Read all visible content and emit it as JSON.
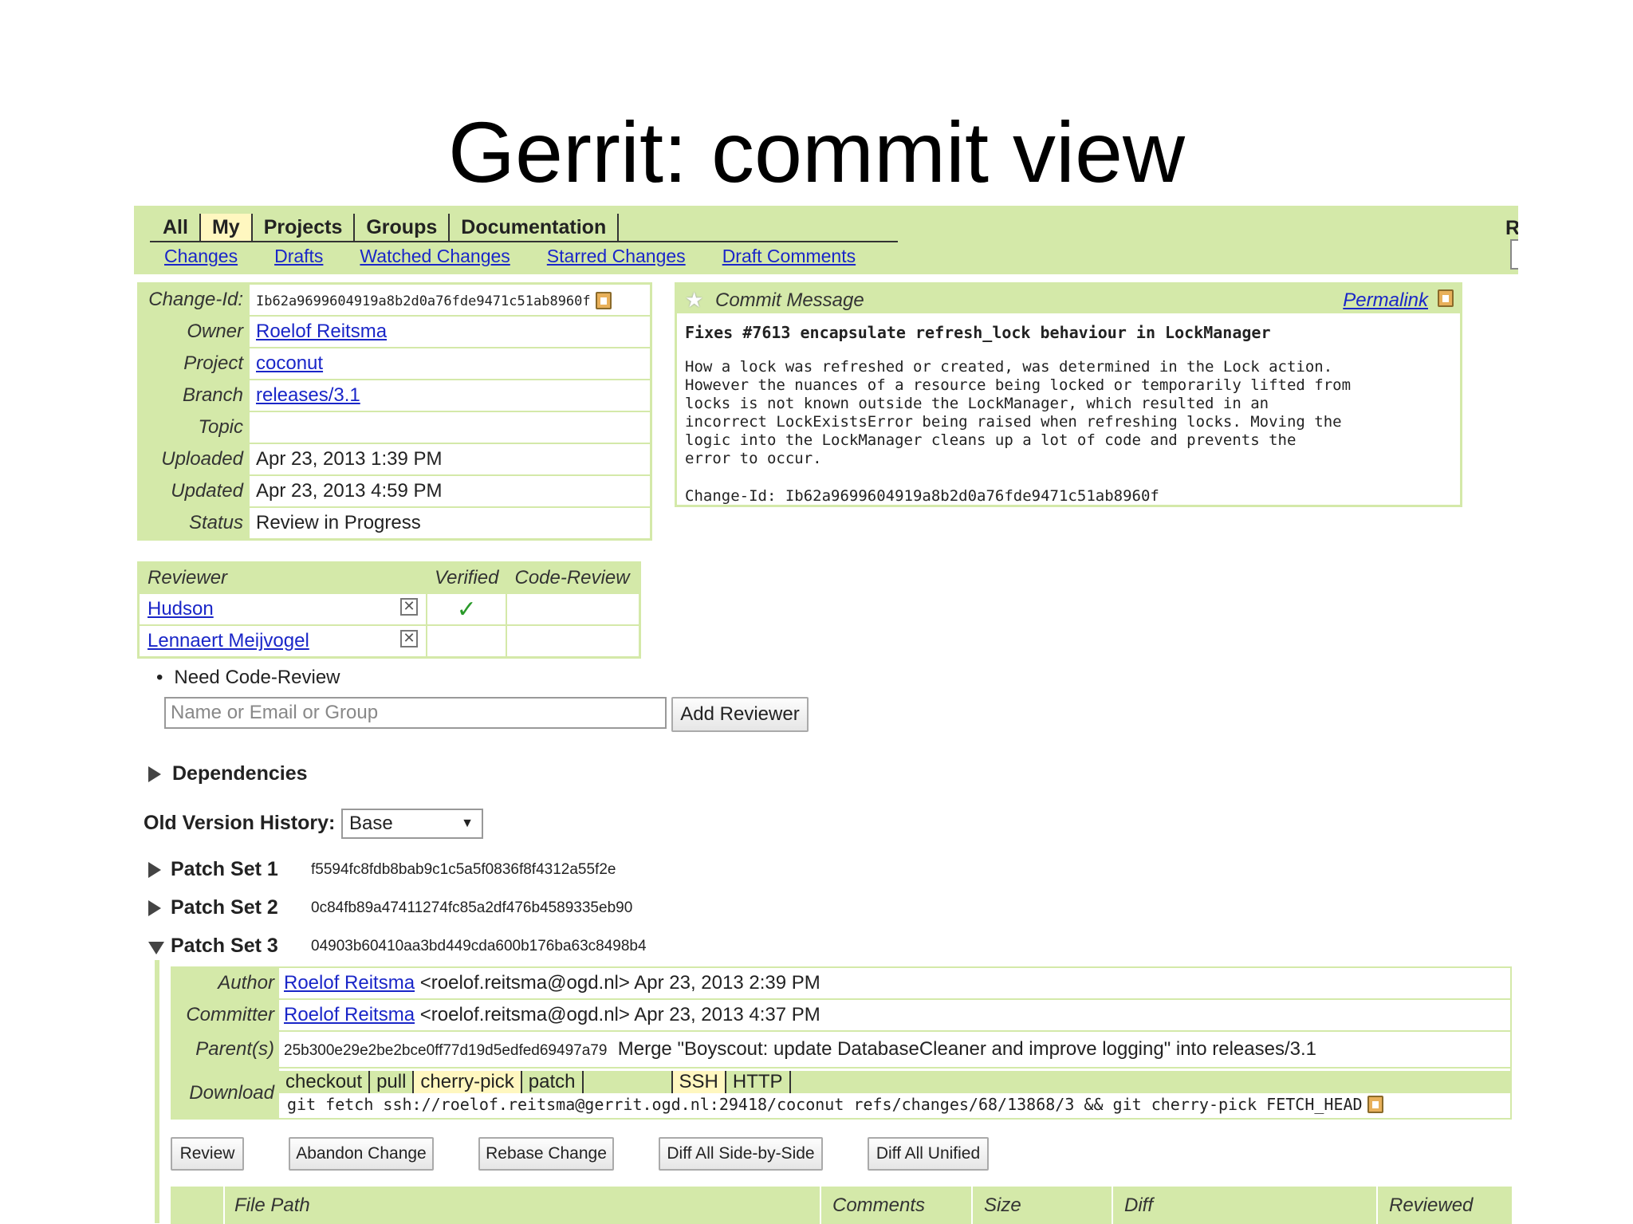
{
  "slide_title": "Gerrit: commit view",
  "menu": {
    "tabs": [
      "All",
      "My",
      "Projects",
      "Groups",
      "Documentation"
    ],
    "selected_tab": "My",
    "subtabs": [
      "Changes",
      "Drafts",
      "Watched Changes",
      "Starred Changes",
      "Draft Comments"
    ],
    "search_label": "Rc"
  },
  "info": {
    "change_id_label": "Change-Id:",
    "change_id": "Ib62a9699604919a8b2d0a76fde9471c51ab8960f",
    "owner_label": "Owner",
    "owner": "Roelof Reitsma",
    "project_label": "Project",
    "project": "coconut",
    "branch_label": "Branch",
    "branch": "releases/3.1",
    "topic_label": "Topic",
    "topic": "",
    "uploaded_label": "Uploaded",
    "uploaded": "Apr 23, 2013 1:39 PM",
    "updated_label": "Updated",
    "updated": "Apr 23, 2013 4:59 PM",
    "status_label": "Status",
    "status": "Review in Progress"
  },
  "commit": {
    "title": "Commit Message",
    "permalink": "Permalink",
    "subject": "Fixes #7613 encapsulate refresh_lock behaviour in LockManager",
    "body": "How a lock was refreshed or created, was determined in the Lock action.\nHowever the nuances of a resource being locked or temporarily lifted from\nlocks is not known outside the LockManager, which resulted in an\nincorrect LockExistsError being raised when refreshing locks. Moving the\nlogic into the LockManager cleans up a lot of code and prevents the\nerror to occur.",
    "change_id_line": "Change-Id: Ib62a9699604919a8b2d0a76fde9471c51ab8960f"
  },
  "reviewers": {
    "headers": [
      "Reviewer",
      "Verified",
      "Code-Review"
    ],
    "rows": [
      {
        "name": "Hudson",
        "verified": "✓",
        "code_review": ""
      },
      {
        "name": "Lennaert Meijvogel",
        "verified": "",
        "code_review": ""
      }
    ],
    "need": "Need Code-Review",
    "input_placeholder": "Name or Email or Group",
    "add_button": "Add Reviewer"
  },
  "dependencies_label": "Dependencies",
  "old_version": {
    "label": "Old Version History:",
    "selected": "Base"
  },
  "patch_sets": [
    {
      "label": "Patch Set 1",
      "hash": "f5594fc8fdb8bab9c1c5a5f0836f8f4312a55f2e",
      "expanded": false
    },
    {
      "label": "Patch Set 2",
      "hash": "0c84fb89a47411274fc85a2df476b4589335eb90",
      "expanded": false
    },
    {
      "label": "Patch Set 3",
      "hash": "04903b60410aa3bd449cda600b176ba63c8498b4",
      "expanded": true
    }
  ],
  "ps3": {
    "author_label": "Author",
    "author_name": "Roelof Reitsma",
    "author_rest": "<roelof.reitsma@ogd.nl> Apr 23, 2013 2:39 PM",
    "committer_label": "Committer",
    "committer_name": "Roelof Reitsma",
    "committer_rest": "<roelof.reitsma@ogd.nl> Apr 23, 2013 4:37 PM",
    "parent_label": "Parent(s)",
    "parent_hash": "25b300e29e2be2bce0ff77d19d5edfed69497a79",
    "parent_msg": "Merge \"Boyscout: update DatabaseCleaner and improve logging\" into releases/3.1",
    "download_label": "Download",
    "download_tabs": [
      "checkout",
      "pull",
      "cherry-pick",
      "patch"
    ],
    "download_selected": "cherry-pick",
    "protocol_tabs": [
      "SSH",
      "HTTP"
    ],
    "protocol_selected": "SSH",
    "download_cmd": "git fetch ssh://roelof.reitsma@gerrit.ogd.nl:29418/coconut refs/changes/68/13868/3 && git cherry-pick FETCH_HEAD"
  },
  "actions": {
    "review": "Review",
    "abandon": "Abandon Change",
    "rebase": "Rebase Change",
    "diff_sbs": "Diff All Side-by-Side",
    "diff_unified": "Diff All Unified"
  },
  "files_header": {
    "file_path": "File Path",
    "comments": "Comments",
    "size": "Size",
    "diff": "Diff",
    "reviewed": "Reviewed"
  }
}
